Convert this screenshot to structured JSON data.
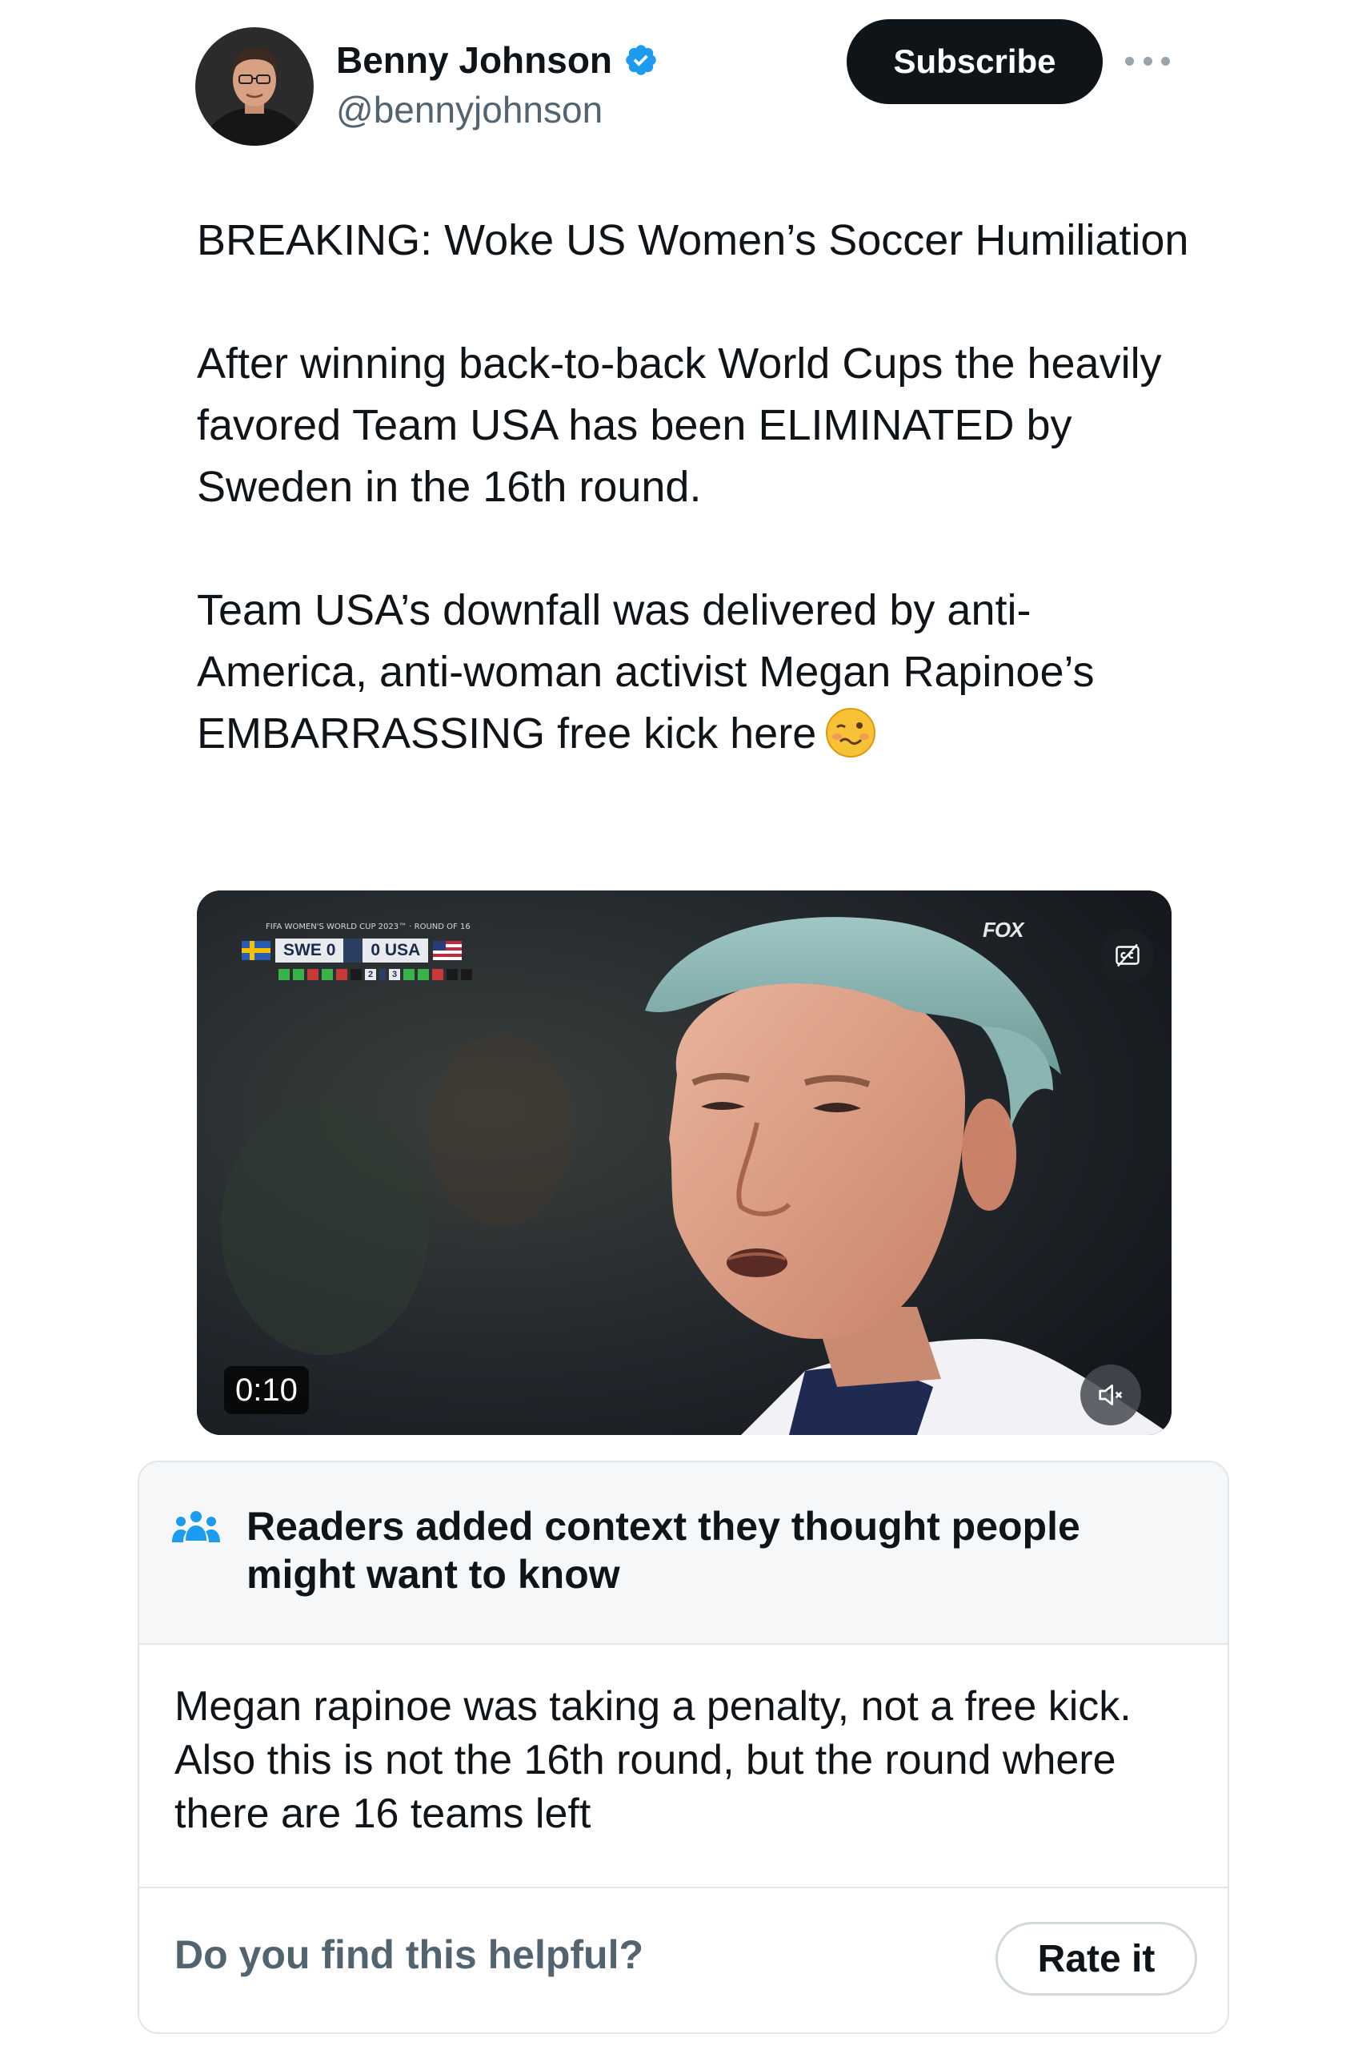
{
  "author": {
    "display_name": "Benny Johnson",
    "handle": "@bennyjohnson",
    "verified": true,
    "avatar_icon": "profile-photo"
  },
  "actions": {
    "subscribe_label": "Subscribe",
    "more_icon": "more-options-icon"
  },
  "tweet": {
    "paragraphs": [
      "BREAKING: Woke US Women’s Soccer Humiliation",
      "After winning back-to-back World Cups the heavily favored Team USA has been ELIMINATED by Sweden in the 16th round.",
      "Team USA’s downfall was delivered by anti-America, anti-woman activist Megan Rapinoe’s EMBARRASSING free kick here"
    ],
    "emoji": "woozy-face-emoji"
  },
  "video": {
    "duration": "0:10",
    "scoreboard": {
      "tournament": "FIFA WOMEN'S WORLD CUP 2023™ · ROUND OF 16",
      "home_team": "SWE",
      "home_score": "0",
      "away_team": "USA",
      "away_score": "0",
      "home_pens": "2",
      "away_pens": "3"
    },
    "broadcaster": "FOX",
    "cc_icon": "closed-captions-icon",
    "mute_icon": "muted-speaker-icon"
  },
  "community_note": {
    "title": "Readers added context they thought people might want to know",
    "icon": "people-group-icon",
    "body": "Megan rapinoe was taking a penalty, not a free kick. Also this is not the 16th round, but the round where there are 16 teams left",
    "helpful_question": "Do you find this helpful?",
    "rate_label": "Rate it"
  },
  "colors": {
    "text_primary": "#0f1419",
    "text_secondary": "#536471",
    "verified_blue": "#1d9bf0",
    "subscribe_bg": "#0f1419",
    "note_header_bg": "#f5f7f9",
    "border": "#e1e6ea"
  }
}
